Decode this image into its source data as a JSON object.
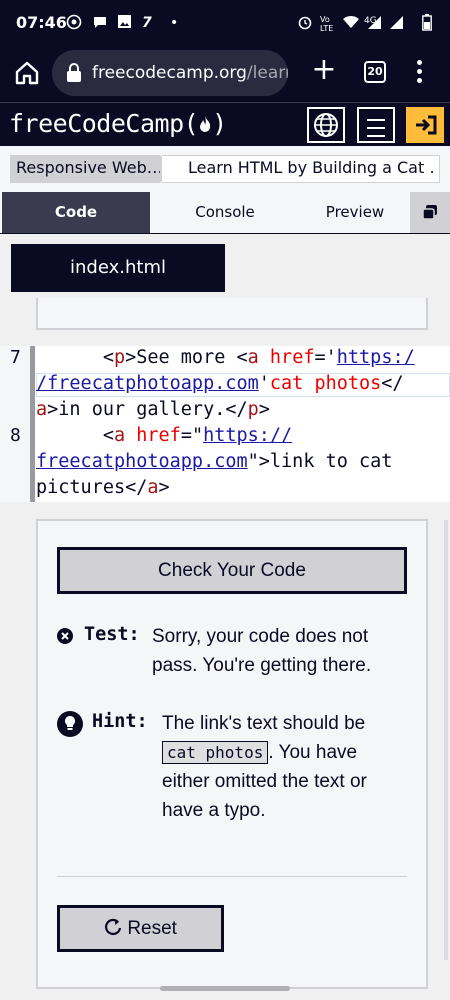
{
  "status_bar": {
    "time": "07:46",
    "left_icons": [
      "whatsapp-icon",
      "chat-bubble-icon",
      "gallery-icon",
      "text-app-icon",
      "dot-icon"
    ],
    "right_icons": [
      "alarm-icon",
      "volte-icon",
      "wifi-icon",
      "4g-signal-icon",
      "signal-icon",
      "battery-icon"
    ],
    "network_label": "4G"
  },
  "browser": {
    "url_host": "freecodecamp.org",
    "url_path": "/learn",
    "tab_count": "20"
  },
  "fcc_nav": {
    "logo_text": "freeCodeCamp(🔥)",
    "logo_main": "freeCodeCamp(",
    "logo_end": ")",
    "accent_color": "#febc3a"
  },
  "breadcrumb": {
    "superblock": "Responsive Web…",
    "challenge": "Learn HTML by Building a Cat …"
  },
  "tabs": {
    "code": "Code",
    "console": "Console",
    "preview": "Preview"
  },
  "editor": {
    "file_name": "index.html",
    "lines": [
      {
        "number": "7",
        "parts": [
          {
            "text": "      <",
            "cls": "p"
          },
          {
            "text": "p",
            "cls": "t"
          },
          {
            "text": ">See more <",
            "cls": "p"
          },
          {
            "text": "a",
            "cls": "t"
          },
          {
            "text": " href",
            "cls": "a"
          },
          {
            "text": "='",
            "cls": "p"
          },
          {
            "text": "https:/",
            "cls": "s"
          }
        ]
      },
      {
        "number": "",
        "parts": [
          {
            "text": "/freecatphotoapp.com",
            "cls": "s"
          },
          {
            "text": "'",
            "cls": "p"
          },
          {
            "text": "cat photos",
            "cls": "a"
          },
          {
            "text": "</",
            "cls": "p"
          }
        ]
      },
      {
        "number": "",
        "parts": [
          {
            "text": "a",
            "cls": "t"
          },
          {
            "text": ">in our gallery.</",
            "cls": "p"
          },
          {
            "text": "p",
            "cls": "t"
          },
          {
            "text": ">",
            "cls": "p"
          }
        ]
      },
      {
        "number": "8",
        "parts": [
          {
            "text": "      <",
            "cls": "p"
          },
          {
            "text": "a",
            "cls": "t"
          },
          {
            "text": " href",
            "cls": "a"
          },
          {
            "text": "=\"",
            "cls": "p"
          },
          {
            "text": "https://",
            "cls": "s"
          }
        ]
      },
      {
        "number": "",
        "parts": [
          {
            "text": "freecatphotoapp.com",
            "cls": "s"
          },
          {
            "text": "\">link to cat",
            "cls": "p"
          }
        ]
      },
      {
        "number": "",
        "parts": [
          {
            "text": "pictures</",
            "cls": "p"
          },
          {
            "text": "a",
            "cls": "t"
          },
          {
            "text": ">",
            "cls": "p"
          }
        ]
      }
    ]
  },
  "instructions": {
    "check_button": "Check Your Code",
    "test_label": "Test:",
    "test_message": "Sorry, your code does not pass. You're getting there.",
    "hint_label": "Hint:",
    "hint_prefix": "The link's text should be",
    "hint_code": "cat photos",
    "hint_suffix": ". You have either omitted the text or have a typo.",
    "reset_button": "Reset"
  }
}
